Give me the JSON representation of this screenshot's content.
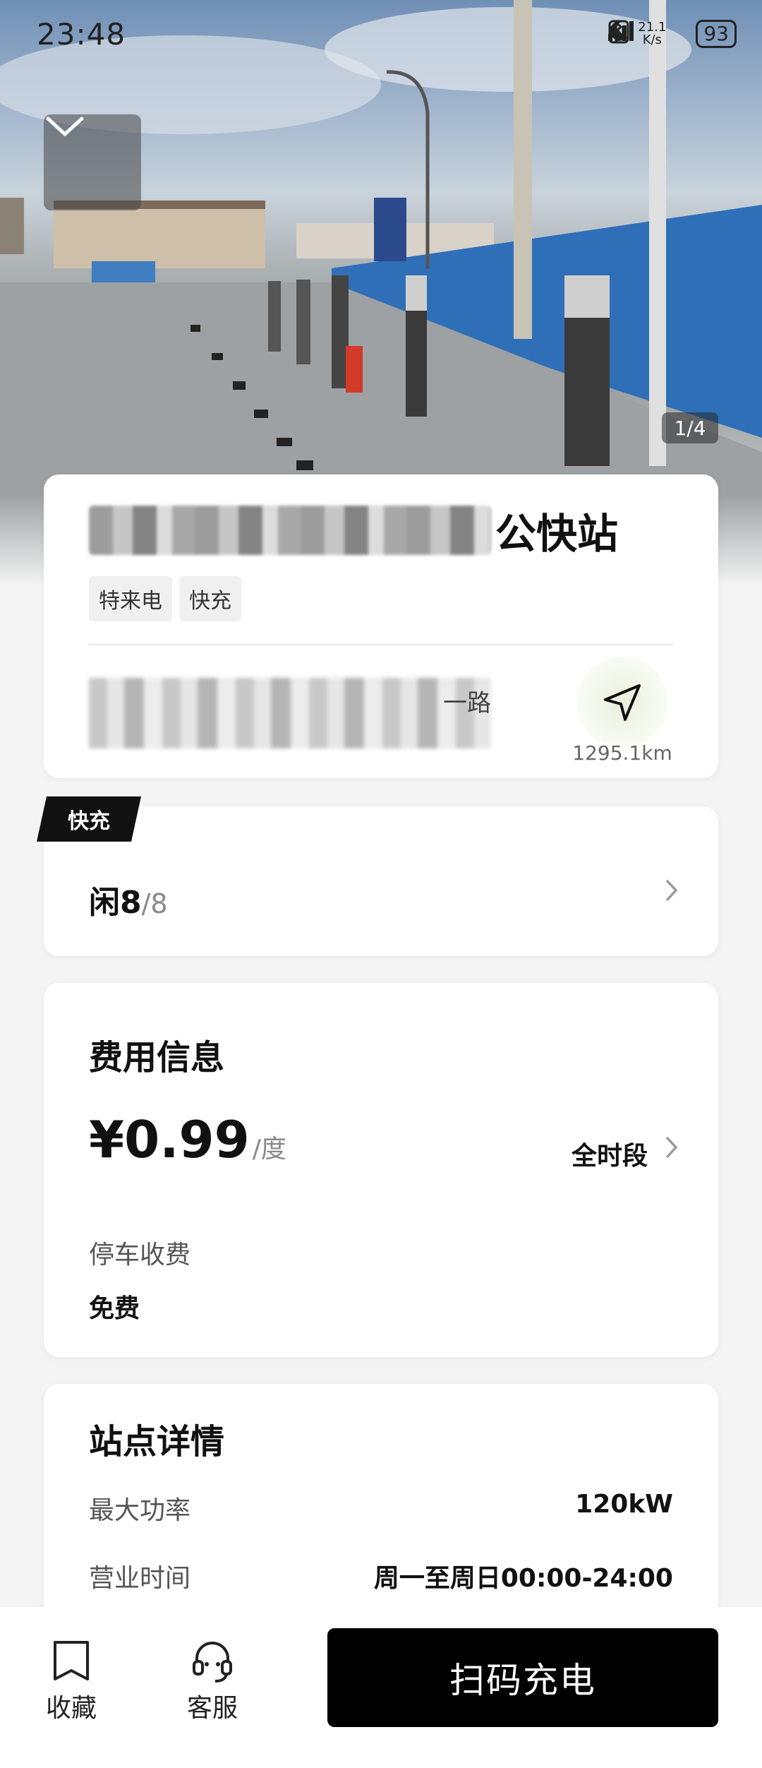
{
  "status_bar": {
    "time": "23:48",
    "net_speed": "21.1\nK/s",
    "battery": "93"
  },
  "gallery": {
    "counter": "1/4"
  },
  "station": {
    "name_visible": "公快站",
    "tags": [
      "特来电",
      "快充"
    ],
    "address_visible": "一路",
    "distance": "1295.1km"
  },
  "fast_charge": {
    "badge": "快充",
    "idle_label": "闲",
    "idle_count": "8",
    "total": "/8"
  },
  "fee": {
    "title": "费用信息",
    "price": "¥0.99",
    "unit": "/度",
    "period": "全时段",
    "parking_label": "停车收费",
    "parking_value": "免费"
  },
  "details": {
    "title": "站点详情",
    "rows": [
      {
        "label": "最大功率",
        "value": "120kW"
      },
      {
        "label": "营业时间",
        "value": "周一至周日00:00-24:00"
      }
    ]
  },
  "bottom_bar": {
    "favorite": "收藏",
    "service": "客服",
    "scan": "扫码充电"
  }
}
